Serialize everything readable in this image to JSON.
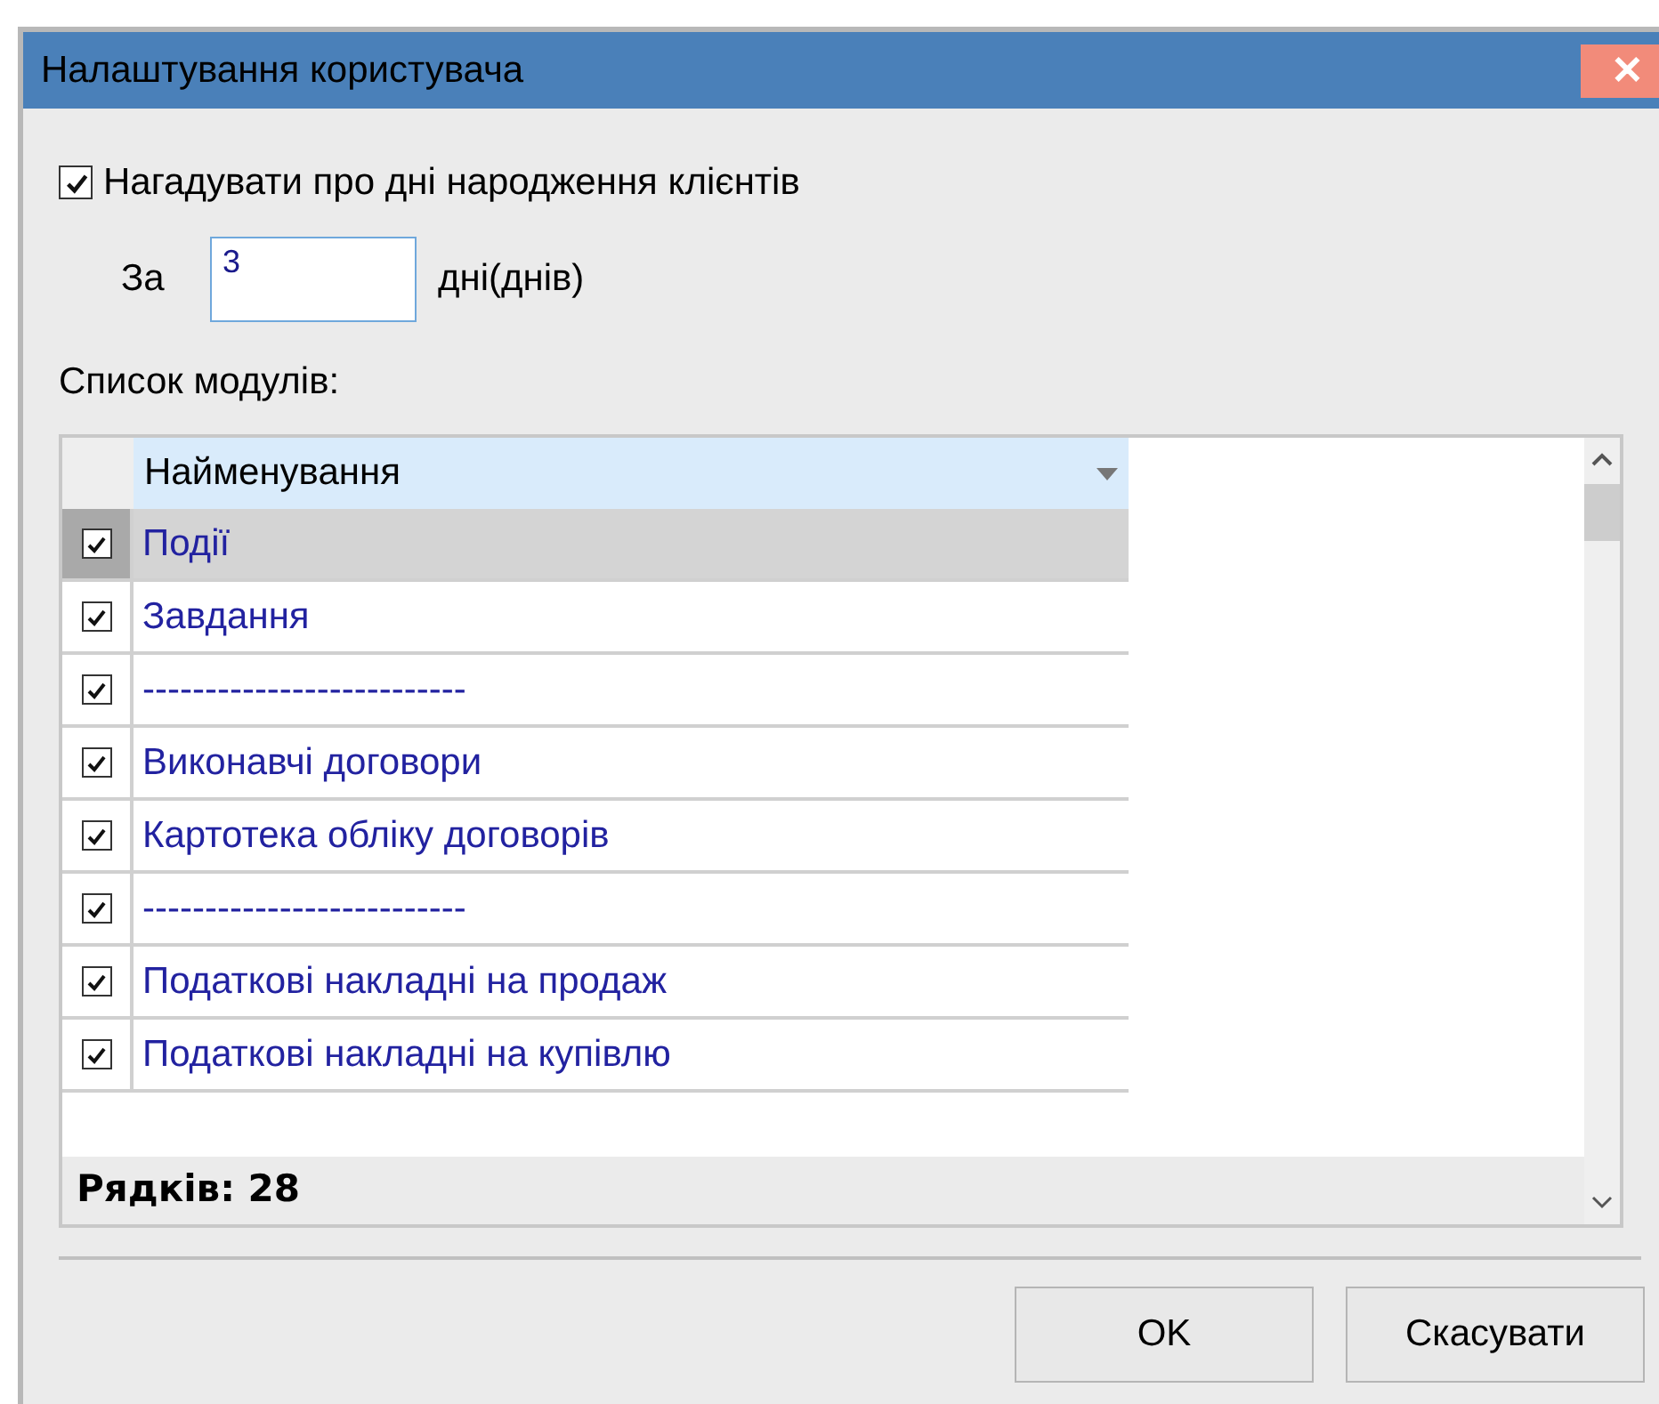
{
  "window": {
    "title": "Налаштування користувача",
    "close": "✕"
  },
  "remind": {
    "label": "Нагадувати про дні народження клієнтів",
    "checked": true
  },
  "days": {
    "prefix": "За",
    "value": "3",
    "suffix": "дні(днів)"
  },
  "list_label": "Список модулів:",
  "table": {
    "columns": [
      {
        "label": "Найменування"
      }
    ],
    "rows": [
      {
        "name": "Події",
        "checked": true,
        "selected": true
      },
      {
        "name": "Завдання",
        "checked": true,
        "selected": false
      },
      {
        "name": "--------------------------",
        "checked": true,
        "selected": false
      },
      {
        "name": "Виконавчі договори",
        "checked": true,
        "selected": false
      },
      {
        "name": "Картотека обліку договорів",
        "checked": true,
        "selected": false
      },
      {
        "name": "--------------------------",
        "checked": true,
        "selected": false
      },
      {
        "name": "Податкові накладні на продаж",
        "checked": true,
        "selected": false
      },
      {
        "name": "Податкові накладні на купівлю",
        "checked": true,
        "selected": false
      }
    ],
    "footer": "Рядків: 28"
  },
  "buttons": [
    "OK",
    "Скасувати"
  ]
}
